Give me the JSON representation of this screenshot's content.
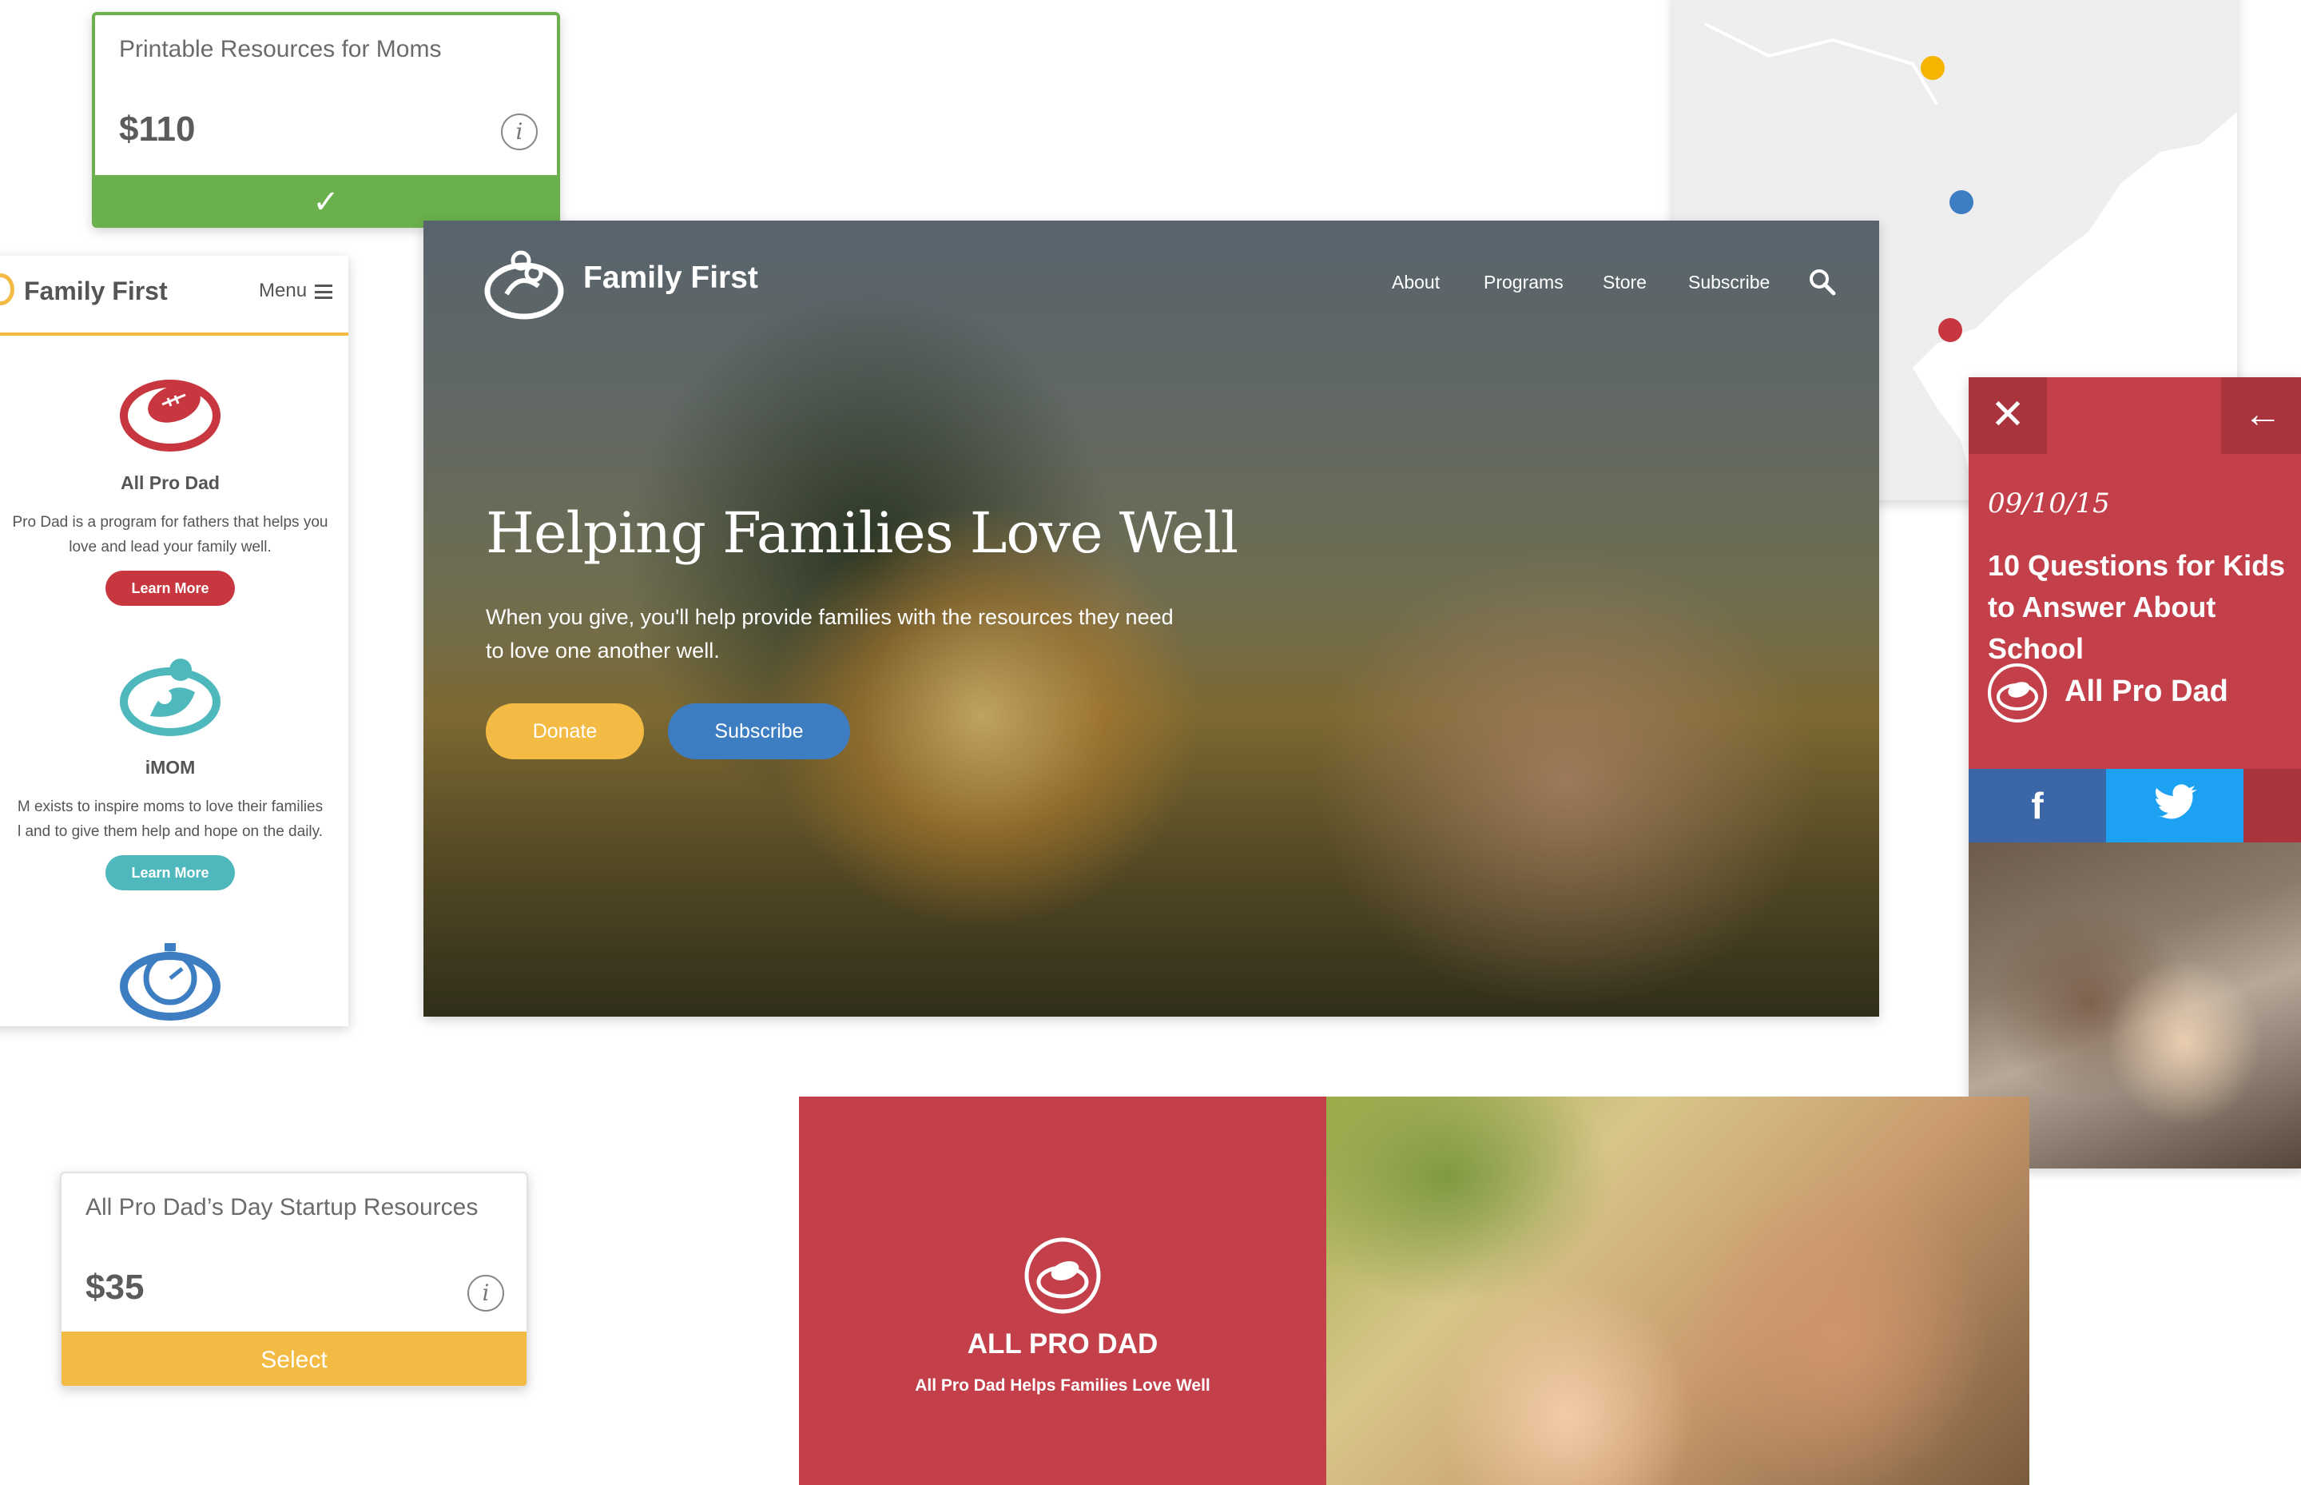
{
  "card1": {
    "title": "Printable Resources for Moms",
    "price": "$110",
    "info_glyph": "i",
    "status_glyph": "✓",
    "accent": "#6ab04c"
  },
  "mobile": {
    "brand": "Family First",
    "menu_label": "Menu",
    "accent": "#f4bb44",
    "programs": [
      {
        "name": "All Pro Dad",
        "description_lines": [
          "Pro Dad is a program for fathers that helps you",
          "love and lead your family well."
        ],
        "button": "Learn More",
        "color": "#c8373f",
        "icon": "football-icon"
      },
      {
        "name": "iMOM",
        "description_lines": [
          "M exists to inspire moms to love their families",
          "l and to give them help and hope on the daily."
        ],
        "button": "Learn More",
        "color": "#4fb8bd",
        "icon": "mom-child-icon"
      },
      {
        "icon": "stopwatch-icon",
        "color": "#3d7dc2"
      }
    ]
  },
  "map": {
    "dots": [
      {
        "color": "#f4b400",
        "label": "yellow-marker"
      },
      {
        "color": "#3d7dc2",
        "label": "blue-marker"
      },
      {
        "color": "#c8373f",
        "label": "red-marker"
      }
    ]
  },
  "hero": {
    "brand": "Family First",
    "nav": [
      "About",
      "Programs",
      "Store",
      "Subscribe"
    ],
    "title": "Helping Families Love Well",
    "subtitle": "When you give, you'll help provide families with the resources they need to love one another well.",
    "donate_label": "Donate",
    "subscribe_label": "Subscribe",
    "donate_color": "#f4bb44",
    "subscribe_color": "#3d7dc2"
  },
  "article": {
    "close_glyph": "✕",
    "back_glyph": "←",
    "date": "09/10/15",
    "title": "10 Questions for Kids to Answer About School",
    "brand": "All Pro Dad",
    "facebook_glyph": "f",
    "colors": {
      "panel": "#c3404a",
      "facebook": "#3b67a8",
      "twitter": "#1da1f2"
    }
  },
  "card2": {
    "title": "All Pro Dad’s Day Startup Resources",
    "price": "$35",
    "info_glyph": "i",
    "select_label": "Select",
    "accent": "#f4bb44"
  },
  "banner": {
    "title": "ALL PRO DAD",
    "subtitle": "All Pro Dad Helps Families Love Well",
    "color": "#c3404a"
  }
}
